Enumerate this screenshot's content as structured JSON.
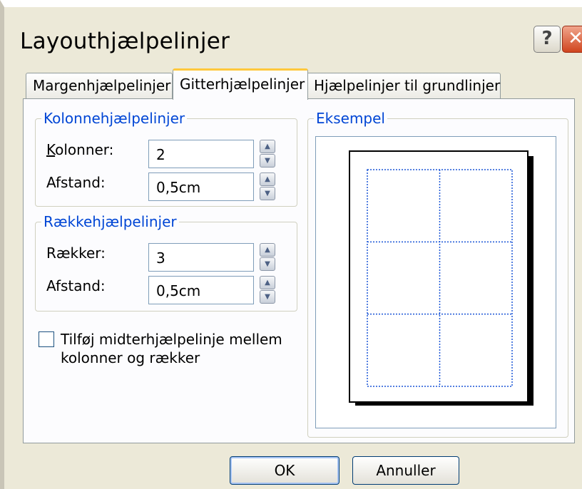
{
  "dialog": {
    "title": "Layouthjælpelinjer",
    "help_glyph": "?",
    "close_glyph": "✕"
  },
  "tabs": [
    {
      "label": "Margenhjælpelinjer",
      "active": false
    },
    {
      "label": "Gitterhjælpelinjer",
      "active": true
    },
    {
      "label": "Hjælpelinjer til grundlinjer",
      "active": false
    }
  ],
  "columns_group": {
    "legend": "Kolonnehjælpelinjer",
    "count_label": "Kolonner:",
    "count_value": "2",
    "spacing_label": "Afstand:",
    "spacing_value": "0,5cm"
  },
  "rows_group": {
    "legend": "Rækkehjælpelinjer",
    "count_label": "Rækker:",
    "count_value": "3",
    "spacing_label": "Afstand:",
    "spacing_value": "0,5cm"
  },
  "center_guide": {
    "line1": "Tilføj midterhjælpelinje mellem",
    "line2": "kolonner og rækker",
    "checked": false
  },
  "preview": {
    "legend": "Eksempel",
    "columns": 2,
    "rows": 3,
    "guide_color": "#1a55d6"
  },
  "buttons": {
    "ok": "OK",
    "cancel": "Annuller"
  }
}
